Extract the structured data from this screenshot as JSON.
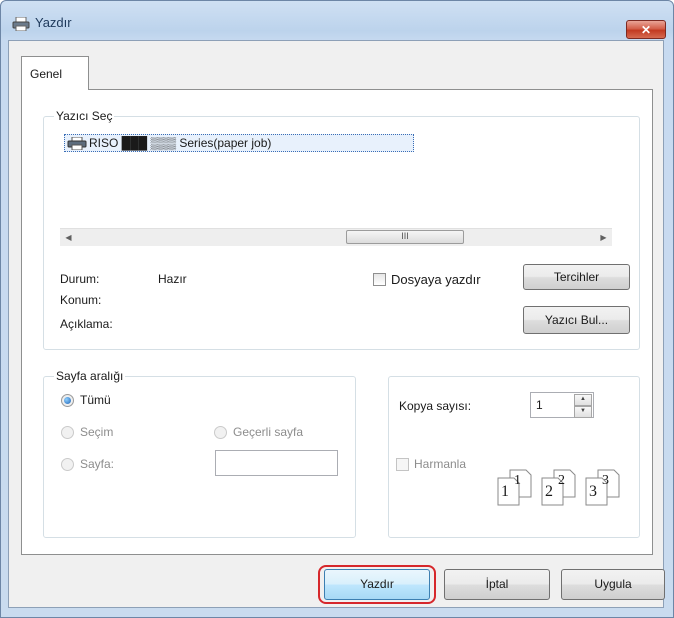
{
  "window": {
    "title": "Yazdır",
    "close_glyph": "✕"
  },
  "tabs": [
    {
      "label": "Genel"
    }
  ],
  "select_printer": {
    "legend": "Yazıcı Seç",
    "printers": [
      {
        "name": "RISO ███ ▒▒▒ Series(paper job)",
        "selected": true
      }
    ],
    "scroll_thumb_glyph": "III"
  },
  "status": {
    "status_label": "Durum:",
    "status_value": "Hazır",
    "location_label": "Konum:",
    "comment_label": "Açıklama:"
  },
  "print_to_file": {
    "label": "Dosyaya yazdır",
    "checked": false
  },
  "buttons": {
    "preferences": "Tercihler",
    "find_printer": "Yazıcı Bul...",
    "print": "Yazdır",
    "cancel": "İptal",
    "apply": "Uygula"
  },
  "page_range": {
    "legend": "Sayfa aralığı",
    "all": "Tümü",
    "selection": "Seçim",
    "current_page": "Geçerli sayfa",
    "pages": "Sayfa:",
    "pages_value": ""
  },
  "copies": {
    "label": "Kopya sayısı:",
    "value": "1",
    "collate_label": "Harmanla",
    "collate_checked": false,
    "collate_pages": [
      "1",
      "1",
      "2",
      "2",
      "3",
      "3"
    ]
  },
  "colors": {
    "close_red": "#c9432a",
    "highlight_red": "#d6272b",
    "selection_blue": "#1f63b5"
  }
}
